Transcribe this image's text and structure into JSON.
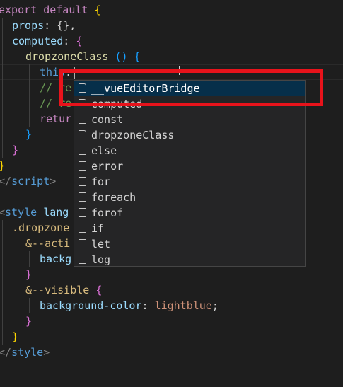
{
  "code": {
    "l1_kw": "export default",
    "l1_brace": " {",
    "l2_prop": "props",
    "l2_rest": ": {},",
    "l3_prop": "computed",
    "l3_colon": ": ",
    "l3_brace": "{",
    "l4_fn": "dropzoneClass",
    "l4_parens": " () ",
    "l4_brace": "{",
    "l5_this": "this",
    "l5_dot": ".",
    "l6_com": "// re",
    "l7_com": "// re",
    "l8_kw": "retur",
    "l9_brace": "}",
    "l10_brace": "}",
    "l11_brace": "}",
    "l12_open": "</",
    "l12_tag": "script",
    "l12_close": ">",
    "l14_open": "<",
    "l14_tag": "style",
    "l14_attr": " lang",
    "l15_sel": ".dropzone",
    "l16_sel": "&--acti",
    "l17_prop": "backg",
    "l18_brace": "}",
    "l19_sel": "&--visible",
    "l19_brace": " {",
    "l20_prop": "background-color",
    "l20_colon": ": ",
    "l20_val": "lightblue",
    "l20_semi": ";",
    "l21_brace": "}",
    "l22_brace": "}",
    "l23_open": "</",
    "l23_tag": "style",
    "l23_close": ">"
  },
  "suggestions": [
    {
      "label": "__vueEditorBridge",
      "icon": "file-icon",
      "selected": true
    },
    {
      "label": "computed",
      "icon": "file-icon",
      "selected": false
    },
    {
      "label": "const",
      "icon": "snippet-icon",
      "selected": false
    },
    {
      "label": "dropzoneClass",
      "icon": "file-icon",
      "selected": false
    },
    {
      "label": "else",
      "icon": "snippet-icon",
      "selected": false
    },
    {
      "label": "error",
      "icon": "snippet-icon",
      "selected": false
    },
    {
      "label": "for",
      "icon": "snippet-icon",
      "selected": false
    },
    {
      "label": "foreach",
      "icon": "snippet-icon",
      "selected": false
    },
    {
      "label": "forof",
      "icon": "snippet-icon",
      "selected": false
    },
    {
      "label": "if",
      "icon": "snippet-icon",
      "selected": false
    },
    {
      "label": "let",
      "icon": "snippet-icon",
      "selected": false
    },
    {
      "label": "log",
      "icon": "snippet-icon",
      "selected": false
    }
  ],
  "colors": {
    "editor_bg": "#1e1e1e",
    "suggest_bg": "#252526",
    "selected_bg": "#062f4a",
    "highlight_border": "#e8131b"
  }
}
